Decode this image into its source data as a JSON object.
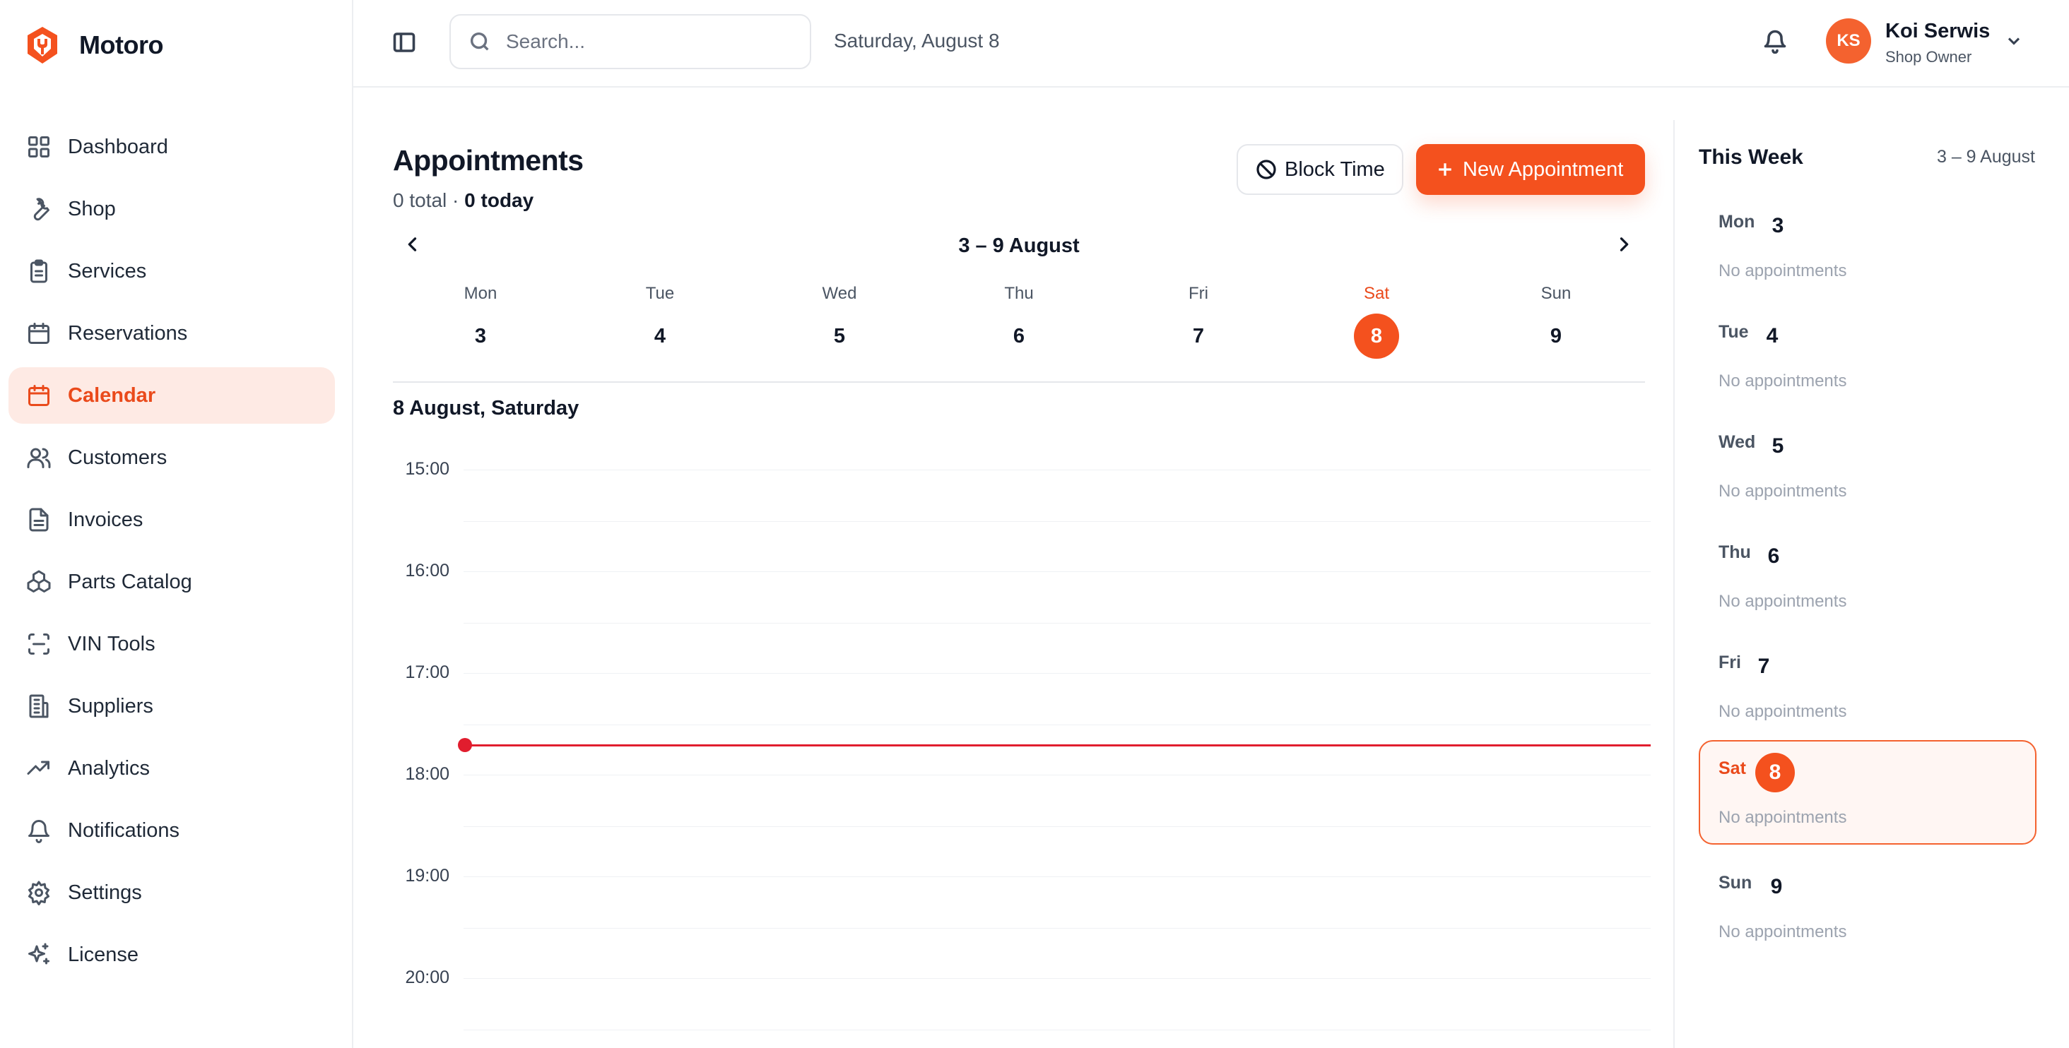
{
  "app": {
    "name": "Motoro",
    "accent": "#f4511e"
  },
  "sidebar": {
    "items": [
      {
        "label": "Dashboard",
        "icon": "layout-grid-icon"
      },
      {
        "label": "Shop",
        "icon": "wrench-icon"
      },
      {
        "label": "Services",
        "icon": "clipboard-icon"
      },
      {
        "label": "Reservations",
        "icon": "calendar-icon"
      },
      {
        "label": "Calendar",
        "icon": "calendar-icon",
        "active": true
      },
      {
        "label": "Customers",
        "icon": "users-icon"
      },
      {
        "label": "Invoices",
        "icon": "file-text-icon"
      },
      {
        "label": "Parts Catalog",
        "icon": "boxes-icon"
      },
      {
        "label": "VIN Tools",
        "icon": "scan-icon"
      },
      {
        "label": "Suppliers",
        "icon": "building-icon"
      },
      {
        "label": "Analytics",
        "icon": "trending-up-icon"
      },
      {
        "label": "Notifications",
        "icon": "bell-icon"
      },
      {
        "label": "Settings",
        "icon": "gear-icon"
      },
      {
        "label": "License",
        "icon": "sparkles-icon"
      }
    ]
  },
  "topbar": {
    "search_placeholder": "Search...",
    "date": "Saturday, August 8",
    "user": {
      "initials": "KS",
      "name": "Koi Serwis",
      "role": "Shop Owner"
    }
  },
  "main": {
    "title": "Appointments",
    "total_text": "0 total",
    "separator": " · ",
    "today_text": "0 today",
    "block_time_label": "Block Time",
    "new_appointment_label": "New Appointment",
    "week_range": "3 – 9 August",
    "days": [
      {
        "name": "Mon",
        "num": "3"
      },
      {
        "name": "Tue",
        "num": "4"
      },
      {
        "name": "Wed",
        "num": "5"
      },
      {
        "name": "Thu",
        "num": "6"
      },
      {
        "name": "Fri",
        "num": "7"
      },
      {
        "name": "Sat",
        "num": "8",
        "today": true
      },
      {
        "name": "Sun",
        "num": "9"
      }
    ],
    "selected_day_label": "8 August, Saturday",
    "hours": [
      "15:00",
      "16:00",
      "17:00",
      "18:00",
      "19:00",
      "20:00"
    ],
    "current_time_hours": 17.7
  },
  "panel": {
    "title": "This Week",
    "range": "3 – 9 August",
    "empty_text": "No appointments",
    "days": [
      {
        "name": "Mon",
        "num": "3"
      },
      {
        "name": "Tue",
        "num": "4"
      },
      {
        "name": "Wed",
        "num": "5"
      },
      {
        "name": "Thu",
        "num": "6"
      },
      {
        "name": "Fri",
        "num": "7"
      },
      {
        "name": "Sat",
        "num": "8",
        "today": true
      },
      {
        "name": "Sun",
        "num": "9"
      }
    ]
  }
}
